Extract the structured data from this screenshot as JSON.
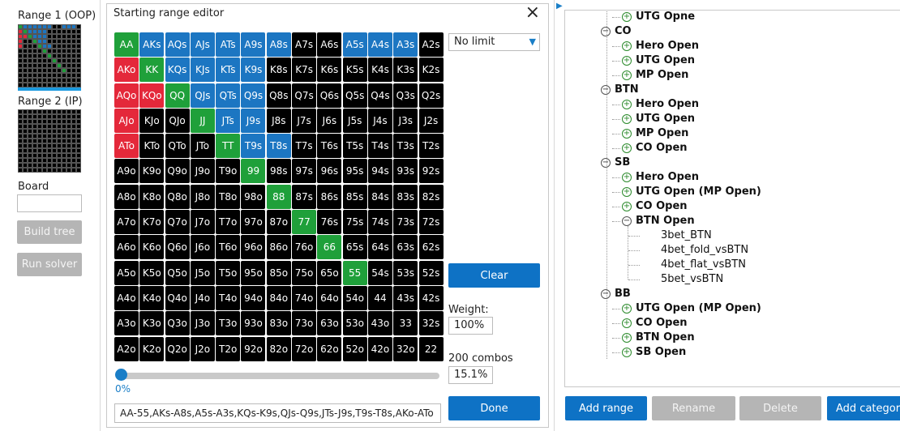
{
  "left_panel": {
    "range1_label": "Range 1 (OOP)",
    "range2_label": "Range 2 (IP)",
    "board_label": "Board",
    "board_value": "",
    "build_tree": "Build tree",
    "run_solver": "Run solver"
  },
  "dialog": {
    "title": "Starting range editor",
    "close": "×",
    "dropdown": "No limit",
    "clear": "Clear",
    "weight_label": "Weight:",
    "weight_value": "100%",
    "combos_label": "200 combos",
    "combos_pct": "15.1%",
    "slider_value": "0%",
    "range_text": "AA-55,AKs-A8s,A5s-A3s,KQs-K9s,QJs-Q9s,JTs-J9s,T9s-T8s,AKo-ATo",
    "done": "Done",
    "grid": [
      [
        "AA",
        "AKs",
        "AQs",
        "AJs",
        "ATs",
        "A9s",
        "A8s",
        "A7s",
        "A6s",
        "A5s",
        "A4s",
        "A3s",
        "A2s"
      ],
      [
        "AKo",
        "KK",
        "KQs",
        "KJs",
        "KTs",
        "K9s",
        "K8s",
        "K7s",
        "K6s",
        "K5s",
        "K4s",
        "K3s",
        "K2s"
      ],
      [
        "AQo",
        "KQo",
        "QQ",
        "QJs",
        "QTs",
        "Q9s",
        "Q8s",
        "Q7s",
        "Q6s",
        "Q5s",
        "Q4s",
        "Q3s",
        "Q2s"
      ],
      [
        "AJo",
        "KJo",
        "QJo",
        "JJ",
        "JTs",
        "J9s",
        "J8s",
        "J7s",
        "J6s",
        "J5s",
        "J4s",
        "J3s",
        "J2s"
      ],
      [
        "ATo",
        "KTo",
        "QTo",
        "JTo",
        "TT",
        "T9s",
        "T8s",
        "T7s",
        "T6s",
        "T5s",
        "T4s",
        "T3s",
        "T2s"
      ],
      [
        "A9o",
        "K9o",
        "Q9o",
        "J9o",
        "T9o",
        "99",
        "98s",
        "97s",
        "96s",
        "95s",
        "94s",
        "93s",
        "92s"
      ],
      [
        "A8o",
        "K8o",
        "Q8o",
        "J8o",
        "T8o",
        "98o",
        "88",
        "87s",
        "86s",
        "85s",
        "84s",
        "83s",
        "82s"
      ],
      [
        "A7o",
        "K7o",
        "Q7o",
        "J7o",
        "T7o",
        "97o",
        "87o",
        "77",
        "76s",
        "75s",
        "74s",
        "73s",
        "72s"
      ],
      [
        "A6o",
        "K6o",
        "Q6o",
        "J6o",
        "T6o",
        "96o",
        "86o",
        "76o",
        "66",
        "65s",
        "64s",
        "63s",
        "62s"
      ],
      [
        "A5o",
        "K5o",
        "Q5o",
        "J5o",
        "T5o",
        "95o",
        "85o",
        "75o",
        "65o",
        "55",
        "54s",
        "53s",
        "52s"
      ],
      [
        "A4o",
        "K4o",
        "Q4o",
        "J4o",
        "T4o",
        "94o",
        "84o",
        "74o",
        "64o",
        "54o",
        "44",
        "43s",
        "42s"
      ],
      [
        "A3o",
        "K3o",
        "Q3o",
        "J3o",
        "T3o",
        "93o",
        "83o",
        "73o",
        "63o",
        "53o",
        "43o",
        "33",
        "32s"
      ],
      [
        "A2o",
        "K2o",
        "Q2o",
        "J2o",
        "T2o",
        "92o",
        "82o",
        "72o",
        "62o",
        "52o",
        "42o",
        "32o",
        "22"
      ]
    ],
    "colors": {
      "pair": "#1fa03a",
      "suited": "#1c76c2",
      "offsuit": "#e4283a",
      "off": "#000000"
    }
  },
  "tree": {
    "top_item": "UTG Opne",
    "groups": [
      {
        "label": "CO",
        "items": [
          "Hero Open",
          "UTG Open",
          "MP Open"
        ]
      },
      {
        "label": "BTN",
        "items": [
          "Hero Open",
          "UTG Open",
          "MP Open",
          "CO Open"
        ]
      },
      {
        "label": "SB",
        "items": [
          "Hero Open",
          "UTG Open (MP Open)",
          "CO Open",
          "BTN Open"
        ],
        "btn_children": [
          "3bet_BTN",
          "4bet_fold_vsBTN",
          "4bet_flat_vsBTN",
          "5bet_vsBTN"
        ]
      },
      {
        "label": "BB",
        "items": [
          "UTG Open (MP Open)",
          "CO Open",
          "BTN Open",
          "SB Open"
        ]
      }
    ]
  },
  "buttons": {
    "add_range": "Add range",
    "rename": "Rename",
    "delete": "Delete",
    "add_category": "Add category"
  }
}
